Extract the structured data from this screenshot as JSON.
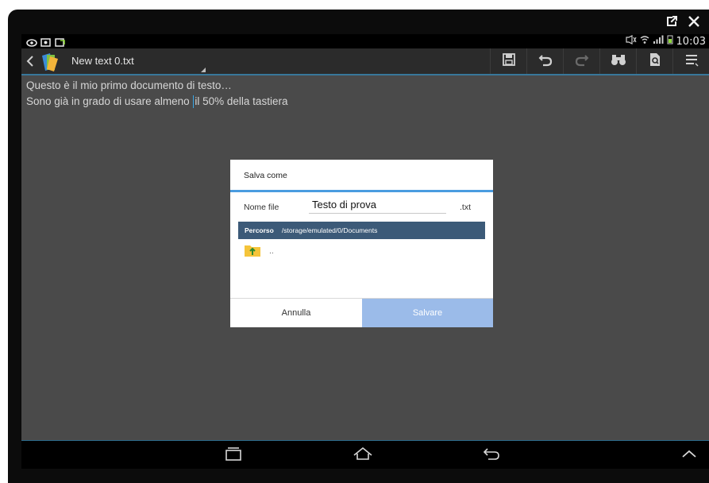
{
  "statusbar": {
    "time": "10:03"
  },
  "actionbar": {
    "title": "New text 0.txt"
  },
  "editor": {
    "line1": "Questo è il mio primo documento di testo…",
    "line2_before": "Sono già in grado di usare almeno ",
    "line2_after": "il 50% della tastiera"
  },
  "dialog": {
    "title": "Salva come",
    "filename_label": "Nome file",
    "filename_value": "Testo di prova",
    "extension": ".txt",
    "path_label": "Percorso",
    "path_value": "/storage/emulated/0/Documents",
    "up_label": "..",
    "cancel_label": "Annulla",
    "save_label": "Salvare"
  },
  "colors": {
    "accent": "#4a9ce0",
    "save_button": "#9bbbe9",
    "path_bar": "#3c5a78"
  }
}
